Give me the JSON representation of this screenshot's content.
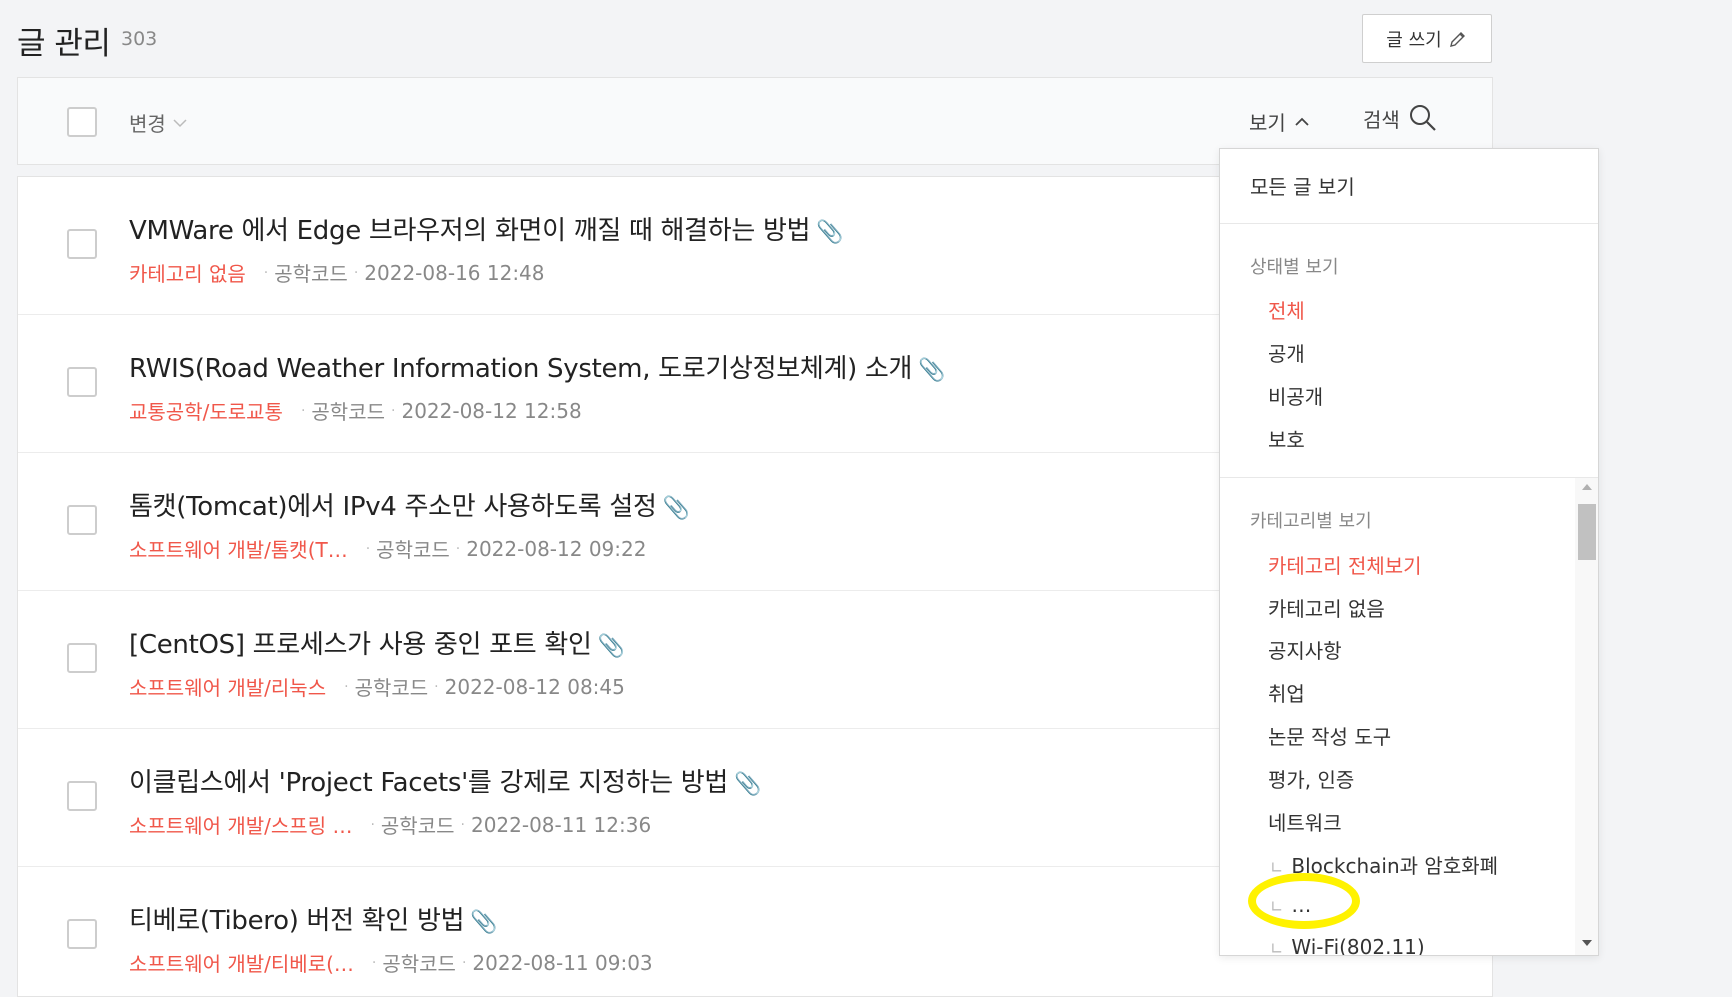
{
  "header": {
    "title": "글 관리",
    "count": "303",
    "write_label": "글 쓰기"
  },
  "toolbar": {
    "change_label": "변경",
    "view_label": "보기",
    "search_label": "검색"
  },
  "posts": [
    {
      "title": "VMWare 에서 Edge 브라우저의 화면이 깨질 때 해결하는 방법",
      "category": "카테고리 없음",
      "author": "공학코드",
      "date": "2022-08-16 12:48"
    },
    {
      "title": "RWIS(Road Weather Information System, 도로기상정보체계) 소개",
      "category": "교통공학/도로교통",
      "author": "공학코드",
      "date": "2022-08-12 12:58"
    },
    {
      "title": "톰캣(Tomcat)에서 IPv4 주소만 사용하도록 설정",
      "category": "소프트웨어 개발/톰캣(T…",
      "author": "공학코드",
      "date": "2022-08-12 09:22"
    },
    {
      "title": "[CentOS] 프로세스가 사용 중인 포트 확인",
      "category": "소프트웨어 개발/리눅스",
      "author": "공학코드",
      "date": "2022-08-12 08:45"
    },
    {
      "title": "이클립스에서 'Project Facets'를 강제로 지정하는 방법",
      "category": "소프트웨어 개발/스프링 …",
      "author": "공학코드",
      "date": "2022-08-11 12:36"
    },
    {
      "title": "티베로(Tibero) 버전 확인 방법",
      "category": "소프트웨어 개발/티베로(…",
      "author": "공학코드",
      "date": "2022-08-11 09:03"
    }
  ],
  "dropdown": {
    "all_posts": "모든 글 보기",
    "status_heading": "상태별 보기",
    "status_items": [
      "전체",
      "공개",
      "비공개",
      "보호"
    ],
    "category_heading": "카테고리별 보기",
    "category_items": [
      "카테고리 전체보기",
      "카테고리 없음",
      "공지사항",
      "취업",
      "논문 작성 도구",
      "평가, 인증",
      "네트워크"
    ],
    "sub_items": [
      "Blockchain과 암호화폐",
      "…",
      "Wi-Fi(802.11)"
    ]
  },
  "colors": {
    "accent": "#f0574a",
    "highlight": "#fff200"
  }
}
